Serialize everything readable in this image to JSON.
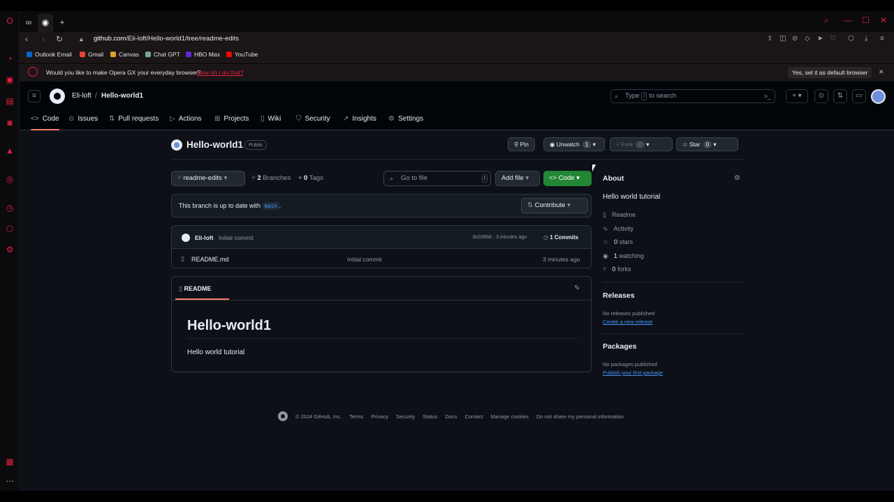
{
  "browser": {
    "url_host": "github.com",
    "url_path": "/Eli-loft/Hello-world1/tree/readme-edits",
    "bookmarks": [
      "Outlook Email",
      "Gmail",
      "Canvas",
      "Chat GPT",
      "HBO Max",
      "YouTube"
    ],
    "bookmark_colors": [
      "#0a64d0",
      "#ea4335",
      "#d9a521",
      "#74aa9c",
      "#5b2bd6",
      "#ff0000"
    ],
    "promo_message": "Would you like to make Opera GX your everyday browser?",
    "promo_link": "How do I do that?",
    "promo_button": "Yes, set it as default browser"
  },
  "github": {
    "owner": "Eli-loft",
    "repo": "Hello-world1",
    "search_placeholder_pre": "Type",
    "search_key": "/",
    "search_placeholder_post": "to search",
    "nav": [
      "Code",
      "Issues",
      "Pull requests",
      "Actions",
      "Projects",
      "Wiki",
      "Security",
      "Insights",
      "Settings"
    ],
    "visibility": "Public",
    "pin": "Pin",
    "unwatch": "Unwatch",
    "watch_count": "1",
    "fork": "Fork",
    "fork_count": "0",
    "star": "Star",
    "star_count": "0",
    "branch": "readme-edits",
    "branches_count": "2",
    "branches_label": "Branches",
    "tags_count": "0",
    "tags_label": "Tags",
    "goto_placeholder": "Go to file",
    "goto_key": "t",
    "add_file": "Add file",
    "code_button": "Code",
    "uptodate_text": "This branch is up to date with",
    "uptodate_branch": "main",
    "uptodate_end": ".",
    "contribute": "Contribute",
    "commit_author": "Eli-loft",
    "commit_message": "Initial commit",
    "commit_sha_time": "8c039b8 · 3 minutes ago",
    "commits_label": "1 Commits",
    "files": [
      {
        "name": "README.md",
        "commit": "Initial commit",
        "time": "3 minutes ago"
      }
    ],
    "readme_tab": "README",
    "readme_heading": "Hello-world1",
    "readme_body": "Hello world tutorial"
  },
  "about": {
    "title": "About",
    "description": "Hello world tutorial",
    "readme": "Readme",
    "activity": "Activity",
    "stars_count": "0",
    "stars_label": "stars",
    "watching_count": "1",
    "watching_label": "watching",
    "forks_count": "0",
    "forks_label": "forks",
    "releases_title": "Releases",
    "releases_none": "No releases published",
    "releases_link": "Create a new release",
    "packages_title": "Packages",
    "packages_none": "No packages published",
    "packages_link": "Publish your first package"
  },
  "footer": [
    "© 2024 GitHub, Inc.",
    "Terms",
    "Privacy",
    "Security",
    "Status",
    "Docs",
    "Contact",
    "Manage cookies",
    "Do not share my personal information"
  ]
}
